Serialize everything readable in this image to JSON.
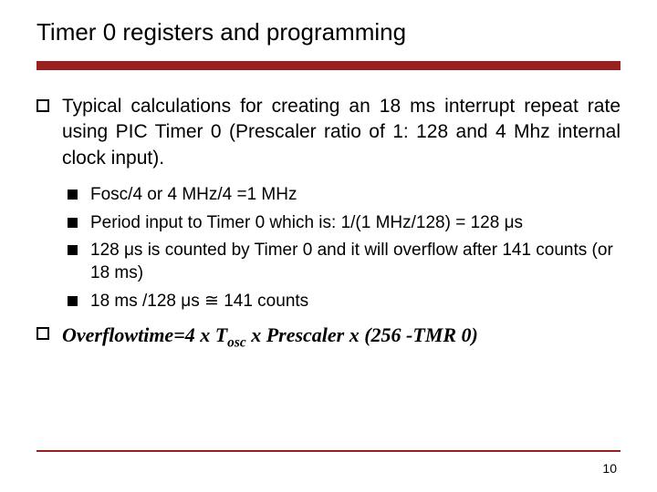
{
  "title": "Timer 0 registers and programming",
  "main_bullets": [
    {
      "text": "Typical calculations for creating an 18 ms interrupt repeat rate using PIC Timer 0 (Prescaler ratio of 1: 128 and 4 Mhz internal clock input)."
    }
  ],
  "sub_bullets": [
    {
      "text": "Fosc/4 or 4 MHz/4 =1 MHz"
    },
    {
      "text": "Period input to Timer 0 which is: 1/(1 MHz/128) = 128 μs"
    },
    {
      "text": "128 μs is counted by Timer 0 and it will overflow after 141 counts (or 18 ms)"
    },
    {
      "text": "18 ms /128 μs ≅ 141 counts"
    }
  ],
  "formula": {
    "lead": "Overflowtime=4 x T",
    "sub": "osc",
    "tail": " x Prescaler x (256 -TMR 0)"
  },
  "page_number": "10"
}
